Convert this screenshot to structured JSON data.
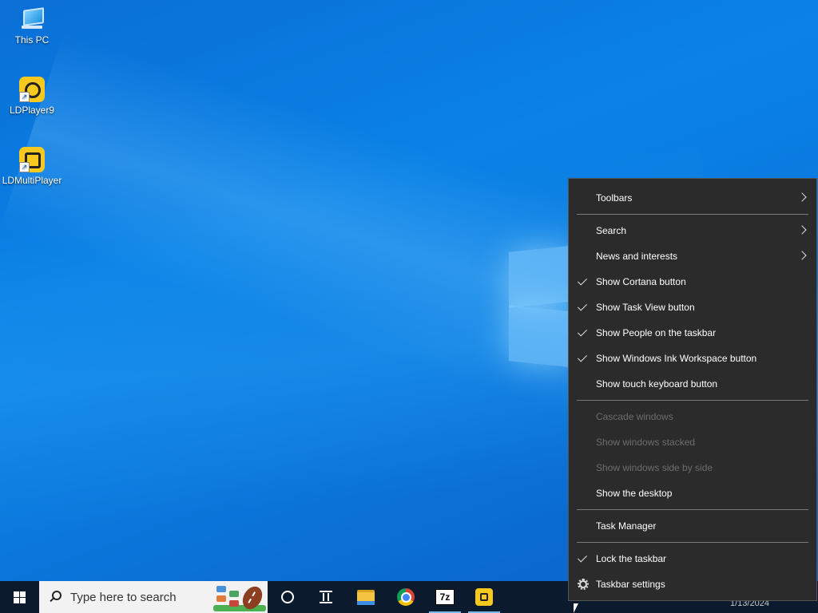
{
  "desktop": {
    "icons": [
      {
        "label": "This PC",
        "icon": "computer-icon"
      },
      {
        "label": "LDPlayer9",
        "icon": "ldplayer-icon"
      },
      {
        "label": "LDMultiPlayer",
        "icon": "ldmultiplayer-icon"
      }
    ]
  },
  "taskbar": {
    "search_placeholder": "Type here to search",
    "pinned": [
      {
        "name": "File Explorer",
        "icon": "folder-icon"
      },
      {
        "name": "Google Chrome",
        "icon": "chrome-icon"
      },
      {
        "name": "7-Zip",
        "icon": "7zip-icon",
        "glyph": "7z"
      },
      {
        "name": "LDPlayer",
        "icon": "ldplayer-icon"
      }
    ],
    "clock_date": "1/13/2024"
  },
  "context_menu": {
    "toolbars": "Toolbars",
    "search": "Search",
    "news": "News and interests",
    "cortana": "Show Cortana button",
    "taskview": "Show Task View button",
    "people": "Show People on the taskbar",
    "ink": "Show Windows Ink Workspace button",
    "touch_keyboard": "Show touch keyboard button",
    "cascade": "Cascade windows",
    "stacked": "Show windows stacked",
    "side_by_side": "Show windows side by side",
    "show_desktop": "Show the desktop",
    "task_manager": "Task Manager",
    "lock": "Lock the taskbar",
    "settings": "Taskbar settings"
  },
  "colors": {
    "desktop_blue": "#0a78dd",
    "taskbar_bg": "#0b1a2d",
    "menu_bg": "#2b2b2b",
    "disabled_text": "#6d6d6d"
  }
}
